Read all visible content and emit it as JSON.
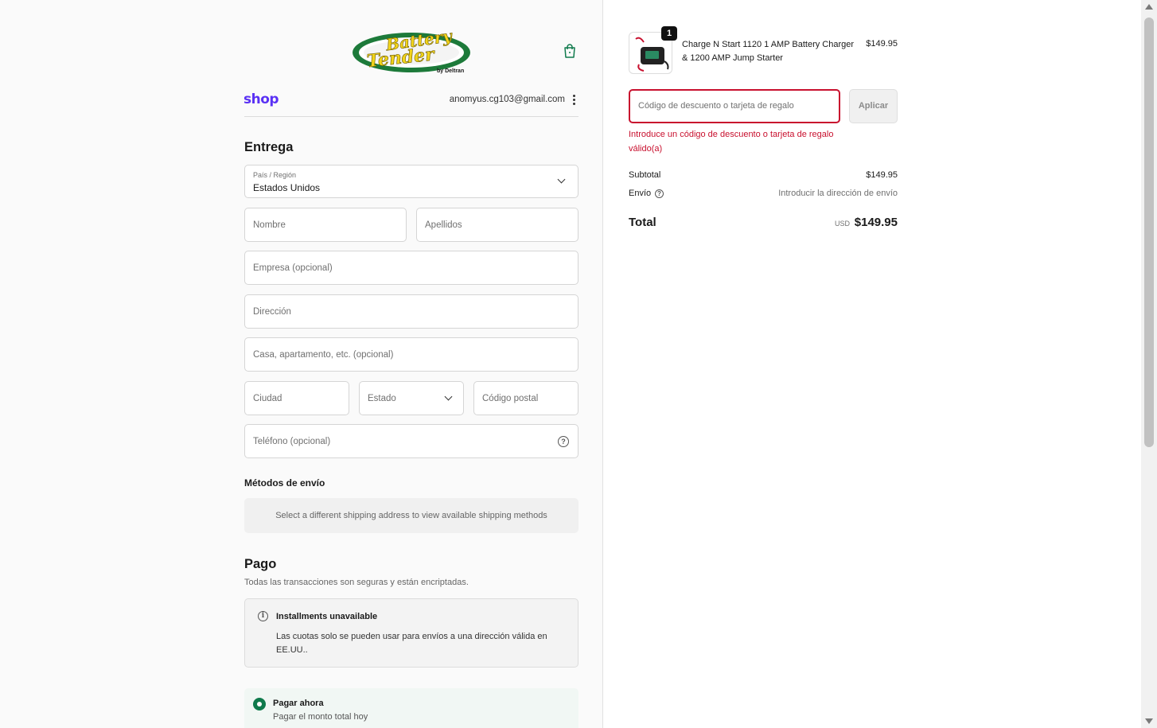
{
  "brand": {
    "logo_line1": "Battery",
    "logo_line2": "Tender",
    "logo_by": "by Deltran",
    "colors": {
      "yellow": "#f2d41a",
      "green": "#1d7a3a",
      "shop_purple": "#5a31f4",
      "error_red": "#c8102e"
    }
  },
  "header": {
    "shop_label": "shop",
    "email": "anomyus.cg103@gmail.com",
    "cart_icon": "shopping-bag-icon",
    "menu_icon": "kebab-menu-icon"
  },
  "delivery": {
    "title": "Entrega",
    "country_label": "País / Región",
    "country_value": "Estados Unidos",
    "first_name_placeholder": "Nombre",
    "last_name_placeholder": "Apellidos",
    "company_placeholder": "Empresa (opcional)",
    "address_placeholder": "Dirección",
    "apartment_placeholder": "Casa, apartamento, etc. (opcional)",
    "city_placeholder": "Ciudad",
    "state_placeholder": "Estado",
    "postal_placeholder": "Código postal",
    "phone_placeholder": "Teléfono (opcional)"
  },
  "shipping": {
    "title": "Métodos de envío",
    "message": "Select a different shipping address to view available shipping methods"
  },
  "payment": {
    "title": "Pago",
    "note": "Todas las transacciones son seguras y están encriptadas.",
    "notice_title": "Installments unavailable",
    "notice_body": "Las cuotas solo se pueden usar para envíos a una dirección válida en EE.UU..",
    "option_label": "Pagar ahora",
    "option_sub": "Pagar el monto total hoy"
  },
  "summary": {
    "product_name": "Charge N Start 1120 1 AMP Battery Charger & 1200 AMP Jump Starter",
    "product_price": "$149.95",
    "quantity": "1",
    "discount_placeholder": "Código de descuento o tarjeta de regalo",
    "apply_label": "Aplicar",
    "error": "Introduce un código de descuento o tarjeta de regalo válido(a)",
    "subtotal_label": "Subtotal",
    "subtotal_value": "$149.95",
    "shipping_label": "Envío",
    "shipping_value": "Introducir la dirección de envío",
    "total_label": "Total",
    "currency": "USD",
    "total_value": "$149.95"
  }
}
